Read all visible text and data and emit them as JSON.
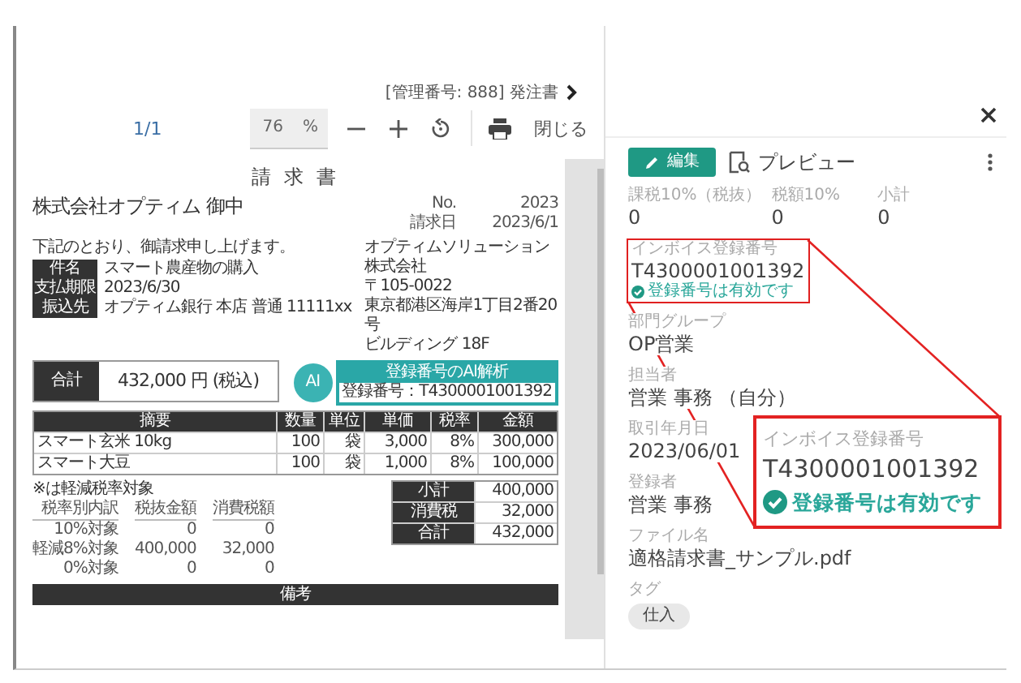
{
  "header": {
    "breadcrumb": "[管理番号: 888] 発注書"
  },
  "viewer": {
    "page": "1/1",
    "zoom": "76",
    "zoom_unit": "%",
    "close": "閉じる"
  },
  "document": {
    "title": "請 求 書",
    "addressee": "株式会社オプティム 御中",
    "meta": [
      {
        "label": "No.",
        "value": "2023"
      },
      {
        "label": "請求日",
        "value": "2023/6/1"
      }
    ],
    "greeting": "下記のとおり、御請求申し上げます。",
    "info": [
      {
        "label": "件名",
        "value": "スマート農産物の購入"
      },
      {
        "label": "支払期限",
        "value": "2023/6/30"
      },
      {
        "label": "振込先",
        "value": "オプティム銀行 本店 普通 11111xx"
      }
    ],
    "issuer": [
      "オプティムソリューション株式会社",
      "〒105-0022",
      "東京都港区海岸1丁目2番20号",
      "ビルディング 18F"
    ],
    "ai_badge": {
      "icon": "AI",
      "title": "登録番号のAI解析",
      "number": "登録番号：T4300001001392"
    },
    "total": {
      "label": "合計",
      "value": "432,000 円 (税込)"
    },
    "items": {
      "columns": [
        "摘要",
        "数量",
        "単位",
        "単価",
        "税率",
        "金額"
      ],
      "rows": [
        [
          "スマート玄米 10kg",
          "100",
          "袋",
          "3,000",
          "8%",
          "300,000"
        ],
        [
          "スマート大豆",
          "100",
          "袋",
          "1,000",
          "8%",
          "100,000"
        ]
      ]
    },
    "reduced_note": "※は軽減税率対象",
    "breakdown": {
      "columns": [
        "税率別内訳",
        "税抜金額",
        "消費税額"
      ],
      "rows": [
        [
          "10%対象",
          "0",
          "0"
        ],
        [
          "軽減8%対象",
          "400,000",
          "32,000"
        ],
        [
          "0%対象",
          "0",
          "0"
        ]
      ]
    },
    "summary": [
      {
        "label": "小計",
        "value": "400,000"
      },
      {
        "label": "消費税",
        "value": "32,000"
      },
      {
        "label": "合計",
        "value": "432,000"
      }
    ],
    "remarks": "備考"
  },
  "panel": {
    "edit": "編集",
    "preview": "プレビュー",
    "amounts": [
      {
        "label": "課税10%（税抜）",
        "value": "0"
      },
      {
        "label": "税額10%",
        "value": "0"
      },
      {
        "label": "小計",
        "value": "0"
      }
    ],
    "fields": [
      {
        "kind": "invoice",
        "label": "インボイス登録番号",
        "value": "T4300001001392",
        "status": "登録番号は有効です",
        "highlighted": true
      },
      {
        "kind": "text",
        "label": "部門グループ",
        "value": "OP営業"
      },
      {
        "kind": "text",
        "label": "担当者",
        "value": "営業 事務 （自分）"
      },
      {
        "kind": "text",
        "label": "取引年月日",
        "value": "2023/06/01"
      },
      {
        "kind": "text",
        "label": "登録者",
        "value": "営業 事務"
      },
      {
        "kind": "text",
        "label": "ファイル名",
        "value": "適格請求書_サンプル.pdf"
      },
      {
        "kind": "tags",
        "label": "タグ",
        "tags": [
          "仕入"
        ]
      }
    ]
  },
  "callout": {
    "label": "インボイス登録番号",
    "value": "T4300001001392",
    "status": "登録番号は有効です"
  }
}
